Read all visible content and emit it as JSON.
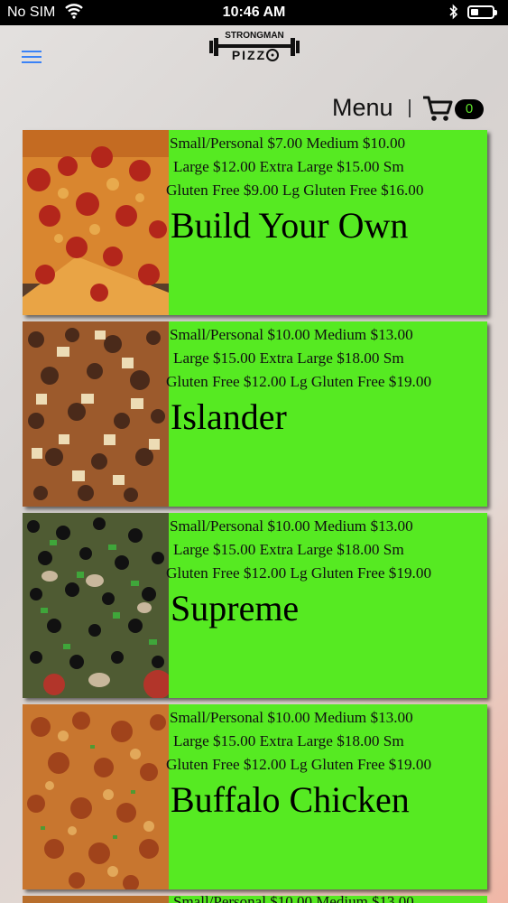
{
  "status": {
    "carrier": "No SIM",
    "time": "10:46 AM"
  },
  "header": {
    "logo_top": "STRONGMAN",
    "logo_bottom": "PIZZ",
    "menu_label": "Menu",
    "cart_count": "0"
  },
  "colors": {
    "card_green": "#56ea22",
    "badge_text": "#5fe32a",
    "hamburger": "#3b82f6"
  },
  "items": [
    {
      "prices": [
        "Small/Personal $7.00   Medium $10.00",
        "Large $12.00   Extra Large $15.00   Sm",
        "Gluten Free $9.00   Lg Gluten Free $16.00"
      ],
      "title": "Build Your Own",
      "image": "pepperoni-pizza"
    },
    {
      "prices": [
        "Small/Personal $10.00   Medium $13.00",
        "Large $15.00   Extra Large $18.00   Sm",
        "Gluten Free $12.00   Lg Gluten Free $19.00"
      ],
      "title": "Islander",
      "image": "islander-pizza"
    },
    {
      "prices": [
        "Small/Personal $10.00   Medium $13.00",
        "Large $15.00   Extra Large $18.00   Sm",
        "Gluten Free $12.00   Lg Gluten Free $19.00"
      ],
      "title": "Supreme",
      "image": "supreme-pizza"
    },
    {
      "prices": [
        "Small/Personal $10.00   Medium $13.00",
        "Large $15.00   Extra Large $18.00   Sm",
        "Gluten Free $12.00   Lg Gluten Free $19.00"
      ],
      "title": "Buffalo Chicken",
      "image": "buffalo-chicken-pizza"
    }
  ],
  "partial_item_text": "Small/Personal $10.00   Medium $13.00"
}
